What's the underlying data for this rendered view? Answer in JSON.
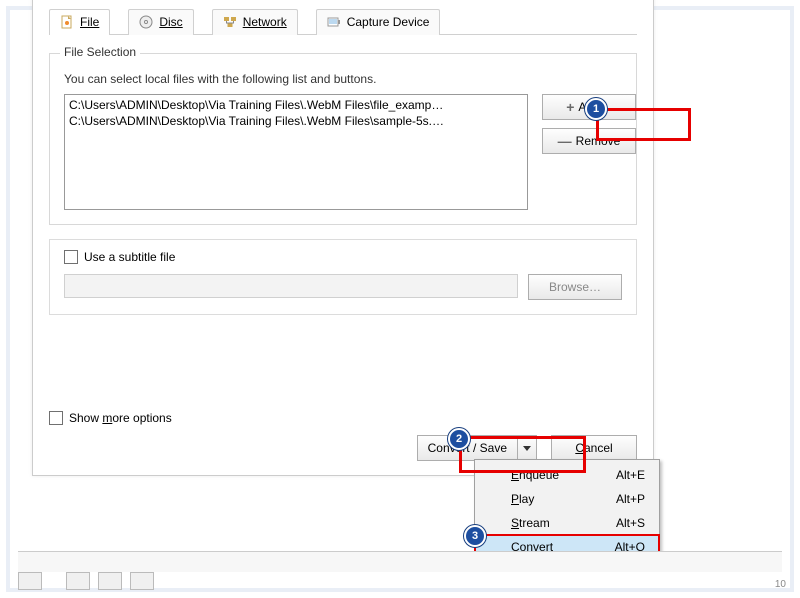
{
  "tabs": {
    "file": "File",
    "disc": "Disc",
    "network": "Network",
    "capture": "Capture Device"
  },
  "file_selection": {
    "legend": "File Selection",
    "hint": "You can select local files with the following list and buttons.",
    "items": [
      "C:\\Users\\ADMIN\\Desktop\\Via Training Files\\.WebM Files\\file_examp…",
      "C:\\Users\\ADMIN\\Desktop\\Via Training Files\\.WebM Files\\sample-5s.…"
    ],
    "add_label": "Add…",
    "remove_label": "Remove"
  },
  "subtitle": {
    "checkbox_label": "Use a subtitle file",
    "checked": false,
    "browse_label": "Browse…"
  },
  "more_options_label": "Show more options",
  "bottom": {
    "convert_save_label": "Convert / Save",
    "cancel_label": "Cancel"
  },
  "menu": {
    "items": [
      {
        "label": "Enqueue",
        "accel": "Alt+E"
      },
      {
        "label": "Play",
        "accel": "Alt+P"
      },
      {
        "label": "Stream",
        "accel": "Alt+S"
      },
      {
        "label": "Convert",
        "accel": "Alt+O",
        "hover": true
      }
    ]
  },
  "badges": {
    "one": "1",
    "two": "2",
    "three": "3"
  },
  "page_number": "10"
}
